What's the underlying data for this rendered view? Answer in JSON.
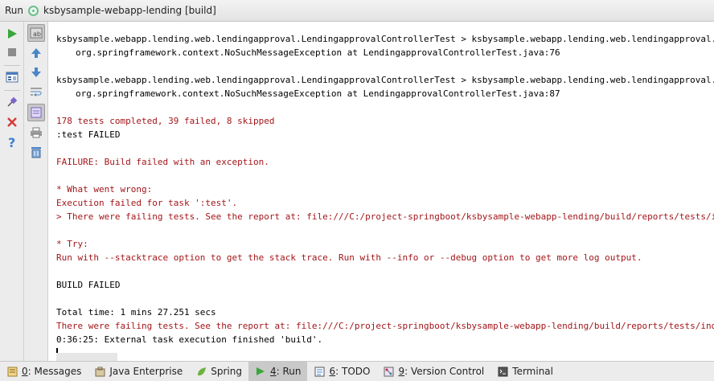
{
  "titlebar": {
    "run_label": "Run",
    "config_name": "ksbysample-webapp-lending [build]"
  },
  "toolbar_left": [
    {
      "name": "run-icon",
      "color": "#3aa63a"
    },
    {
      "name": "stop-icon",
      "color": "#8c8c8c"
    },
    {
      "name": "restore-layout-icon",
      "color": "#4a7cbf"
    },
    {
      "name": "pin-icon",
      "color": "#7b64c8"
    },
    {
      "name": "close-icon",
      "color": "#d63b3b"
    },
    {
      "name": "help-icon",
      "color": "#3f7fcf"
    }
  ],
  "toolbar_right": [
    {
      "name": "soft-wrap-icon"
    },
    {
      "name": "up-arrow-icon"
    },
    {
      "name": "down-arrow-icon"
    },
    {
      "name": "use-soft-wraps-icon"
    },
    {
      "name": "scroll-to-end-icon"
    },
    {
      "name": "print-icon"
    },
    {
      "name": "clear-all-icon"
    }
  ],
  "console": {
    "lines": [
      {
        "text": "ksbysample.webapp.lending.web.lendingapproval.LendingapprovalControllerTest > ksbysample.webapp.lending.web.lendingapproval.LendingapprovalControllerTest",
        "style": "black",
        "indent": false
      },
      {
        "text": "org.springframework.context.NoSuchMessageException at LendingapprovalControllerTest.java:76",
        "style": "black",
        "indent": true
      },
      {
        "text": "ksbysample.webapp.lending.web.lendingapproval.LendingapprovalControllerTest > ksbysample.webapp.lending.web.lendingapproval.LendingapprovalControllerTest",
        "style": "black",
        "indent": false
      },
      {
        "text": "org.springframework.context.NoSuchMessageException at LendingapprovalControllerTest.java:87",
        "style": "black",
        "indent": true
      },
      {
        "text": "178 tests completed, 39 failed, 8 skipped",
        "style": "red",
        "indent": false
      },
      {
        "text": ":test FAILED",
        "style": "black",
        "indent": false
      },
      {
        "text": "FAILURE: Build failed with an exception.",
        "style": "red",
        "indent": false
      },
      {
        "text": "* What went wrong:",
        "style": "red",
        "indent": false
      },
      {
        "text": "Execution failed for task ':test'.",
        "style": "red",
        "indent": false
      },
      {
        "text": "> There were failing tests. See the report at: file:///C:/project-springboot/ksbysample-webapp-lending/build/reports/tests/index.html",
        "style": "red",
        "indent": false
      },
      {
        "text": "* Try:",
        "style": "red",
        "indent": false
      },
      {
        "text": "Run with --stacktrace option to get the stack trace. Run with --info or --debug option to get more log output.",
        "style": "red",
        "indent": false
      },
      {
        "text": "BUILD FAILED",
        "style": "black",
        "indent": false
      },
      {
        "text": "Total time: 1 mins 27.251 secs",
        "style": "black",
        "indent": false
      },
      {
        "text": "There were failing tests. See the report at: file:///C:/project-springboot/ksbysample-webapp-lending/build/reports/tests/index.html",
        "style": "red",
        "indent": false
      },
      {
        "text": "0:36:25: External task execution finished 'build'.",
        "style": "black",
        "indent": false
      }
    ]
  },
  "bottom_tabs": [
    {
      "key": "0",
      "label": ": Messages",
      "icon": "messages-icon",
      "active": false
    },
    {
      "key": "",
      "label": "Java Enterprise",
      "icon": "java-enterprise-icon",
      "active": false
    },
    {
      "key": "",
      "label": "Spring",
      "icon": "spring-icon",
      "active": false
    },
    {
      "key": "4",
      "label": ": Run",
      "icon": "run-icon",
      "active": true
    },
    {
      "key": "6",
      "label": ": TODO",
      "icon": "todo-icon",
      "active": false
    },
    {
      "key": "9",
      "label": ": Version Control",
      "icon": "version-control-icon",
      "active": false
    },
    {
      "key": "",
      "label": "Terminal",
      "icon": "terminal-icon",
      "active": false
    }
  ]
}
